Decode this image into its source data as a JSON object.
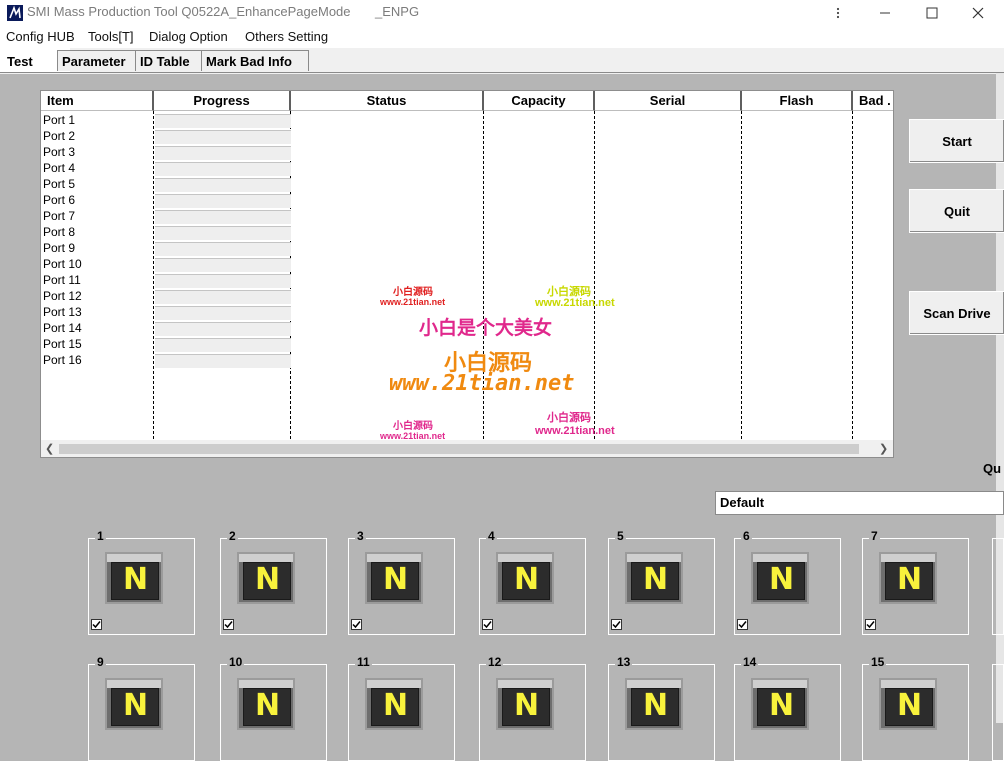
{
  "window": {
    "title": "SMI Mass Production Tool Q0522A_EnhancePageMode",
    "title_suffix": "_ENPG",
    "minimize": "–",
    "close": "✕"
  },
  "menu": [
    "Config HUB",
    "Tools[T]",
    "Dialog Option",
    "Others Setting"
  ],
  "tabs": [
    "Test",
    "Parameter",
    "ID Table",
    "Mark Bad Info"
  ],
  "table": {
    "columns": [
      "Item",
      "Progress",
      "Status",
      "Capacity",
      "Serial",
      "Flash",
      "Bad ."
    ],
    "ports": [
      "Port 1",
      "Port 2",
      "Port 3",
      "Port 4",
      "Port 5",
      "Port 6",
      "Port 7",
      "Port 8",
      "Port 9",
      "Port 10",
      "Port 11",
      "Port 12",
      "Port 13",
      "Port 14",
      "Port 15",
      "Port 16"
    ]
  },
  "watermark": {
    "site_small": "www.21tian.net",
    "brand_small": "小白源码",
    "slogan": "小白是个大美女",
    "brand_large": "小白源码",
    "site_large": "www.21tian.net"
  },
  "buttons": {
    "start": "Start",
    "quit": "Quit",
    "scan": "Scan Drive"
  },
  "side_label": "Qu",
  "profile": "Default",
  "drive_letter": "N",
  "slots_row1": [
    "1",
    "2",
    "3",
    "4",
    "5",
    "6",
    "7"
  ],
  "slots_row2": [
    "9",
    "10",
    "11",
    "12",
    "13",
    "14",
    "15"
  ],
  "colors": {
    "watermark_red": "#e02020",
    "watermark_pink": "#e0288c",
    "watermark_orange": "#f08a10",
    "watermark_green": "#c8d800",
    "drive_letter": "#f8f23c"
  }
}
